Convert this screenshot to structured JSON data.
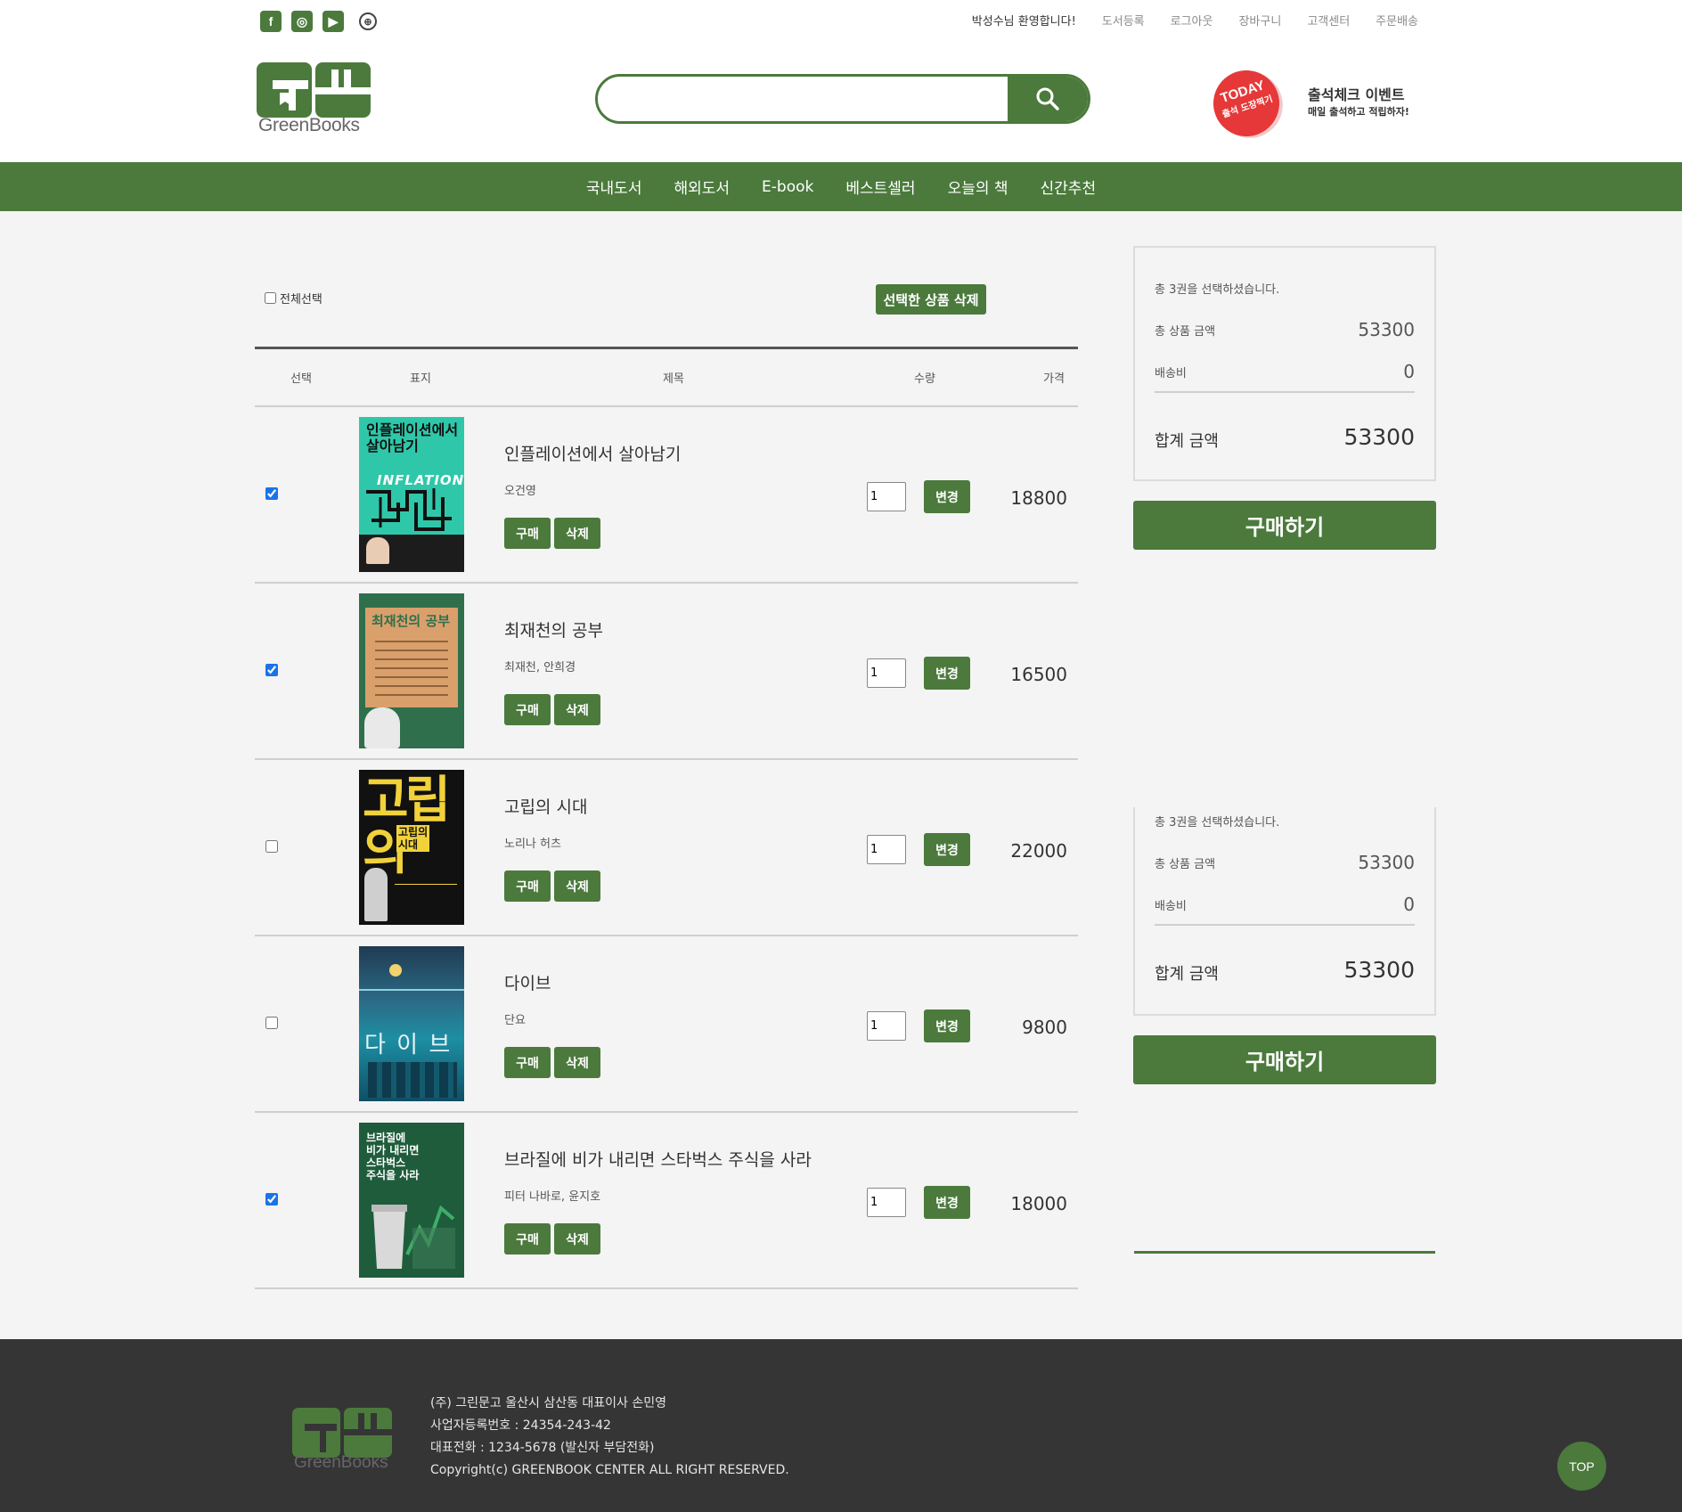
{
  "brand": {
    "name": "GreenBooks",
    "accent": "#4b7a3c"
  },
  "social_icons": [
    "facebook-icon",
    "instagram-icon",
    "youtube-icon",
    "globe-icon"
  ],
  "top_nav": {
    "welcome": "박성수님 환영합니다!",
    "links": [
      "도서등록",
      "로그아웃",
      "장바구니",
      "고객센터",
      "주문배송"
    ]
  },
  "search": {
    "value": "",
    "placeholder": ""
  },
  "event": {
    "badge_top": "TODAY",
    "badge_bottom": "출석 도장찍기",
    "title": "출석체크 이벤트",
    "subtitle": "매일 출석하고 적립하자!"
  },
  "main_nav": [
    "국내도서",
    "해외도서",
    "E-book",
    "베스트셀러",
    "오늘의 책",
    "신간추천"
  ],
  "cart": {
    "select_all_label": "전체선택",
    "delete_selected_label": "선택한 상품 삭제",
    "headers": {
      "select": "선택",
      "cover": "표지",
      "title": "제목",
      "qty": "수량",
      "price": "가격"
    },
    "buy_label": "구매",
    "delete_label": "삭제",
    "change_label": "변경",
    "items": [
      {
        "title": "인플레이션에서 살아남기",
        "author": "오건영",
        "qty": "1",
        "price": "18800",
        "checked": true
      },
      {
        "title": "최재천의 공부",
        "author": "최재천, 안희경",
        "qty": "1",
        "price": "16500",
        "checked": true
      },
      {
        "title": "고립의 시대",
        "author": "노리나 허츠",
        "qty": "1",
        "price": "22000",
        "checked": false
      },
      {
        "title": "다이브",
        "author": "단요",
        "qty": "1",
        "price": "9800",
        "checked": false
      },
      {
        "title": "브라질에 비가 내리면 스타벅스 주식을 사라",
        "author": "피터 나바로, 윤지호",
        "qty": "1",
        "price": "18000",
        "checked": true
      }
    ]
  },
  "covers": {
    "c1": {
      "title1": "인플레이션에서",
      "title2": "살아남기",
      "eng": "INFLATION"
    },
    "c2": {
      "title": "최재천의 공부"
    },
    "c3": {
      "big": "고립의",
      "small1": "고립의",
      "small2": "시대"
    },
    "c4": {
      "title": "다 이 브"
    },
    "c5": {
      "line1": "브라질에",
      "line2": "비가 내리면",
      "line3": "스타벅스",
      "line4": "주식을 사라"
    }
  },
  "summary": {
    "count_text": "총 3권을 선택하셨습니다.",
    "subtotal_label": "총 상품 금액",
    "subtotal_value": "53300",
    "shipping_label": "배송비",
    "shipping_value": "0",
    "total_label": "합계 금액",
    "total_value": "53300",
    "purchase_label": "구매하기"
  },
  "footer": {
    "line1": "(주) 그린문고 울산시 삼산동 대표이사 손민영",
    "line2": "사업자등록번호 : 24354-243-42",
    "line3": "대표전화 : 1234-5678 (발신자 부담전화)",
    "line4": "Copyright(c) GREENBOOK CENTER ALL RIGHT RESERVED.",
    "top_label": "TOP"
  }
}
